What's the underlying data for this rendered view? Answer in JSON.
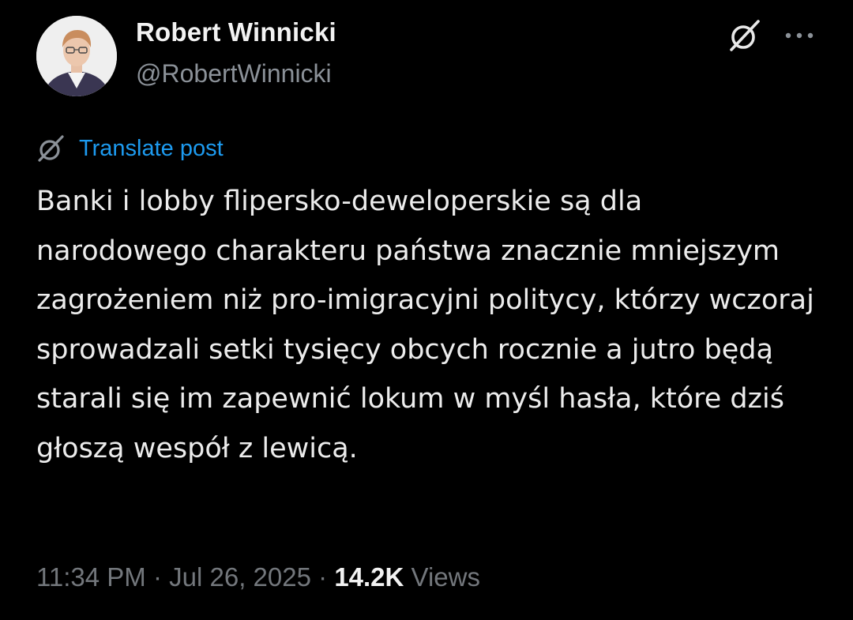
{
  "author": {
    "display_name": "Robert Winnicki",
    "handle": "@RobertWinnicki",
    "avatar_icon": "user-avatar"
  },
  "header_actions": {
    "grok_icon": "grok-icon",
    "more_icon": "more-horizontal-icon"
  },
  "translate": {
    "label": "Translate post",
    "icon": "translate-icon",
    "color": "#1d9bf0"
  },
  "post": {
    "text": "Banki i lobby flipersko-deweloperskie są dla narodowego charakteru państwa znacznie mniejszym zagrożeniem niż pro-imigracyjni politycy, którzy wczoraj sprowadzali setki tysięcy obcych rocznie a jutro będą starali się im zapewnić lokum w myśl hasła, które dziś głoszą wespół z lewicą."
  },
  "meta": {
    "time": "11:34 PM",
    "separator": "·",
    "date": "Jul 26, 2025",
    "views_count": "14.2K",
    "views_label": "Views"
  },
  "colors": {
    "background": "#000000",
    "text": "#e7e9ea",
    "muted": "#73777c",
    "accent": "#1d9bf0"
  }
}
